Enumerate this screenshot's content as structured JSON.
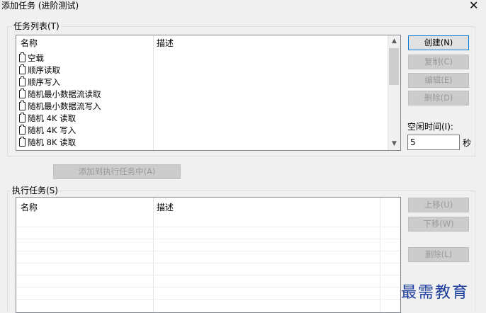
{
  "window": {
    "title": "添加任务 (进阶测试)",
    "close_glyph": "✕"
  },
  "task_list": {
    "group_label": "任务列表(T)",
    "columns": [
      "名称",
      "描述"
    ],
    "items": [
      "空载",
      "顺序读取",
      "顺序写入",
      "随机最小数据流读取",
      "随机最小数据流写入",
      "随机 4K 读取",
      "随机 4K 写入",
      "随机 8K 读取"
    ],
    "scroll_up": "▲",
    "scroll_down": "▼"
  },
  "right_buttons": {
    "create": "创建(N)",
    "copy": "复制(C)",
    "edit": "编辑(E)",
    "delete": "删除(D)"
  },
  "idle": {
    "label": "空闲时间(I):",
    "value": "5",
    "unit": "秒"
  },
  "add_button": "添加到执行任务中(A)",
  "exec_tasks": {
    "group_label": "执行任务(S)",
    "columns": [
      "名称",
      "描述"
    ],
    "move_up": "上移(U)",
    "move_down": "下移(W)",
    "delete": "删除(L)"
  },
  "watermark": "最需教育"
}
